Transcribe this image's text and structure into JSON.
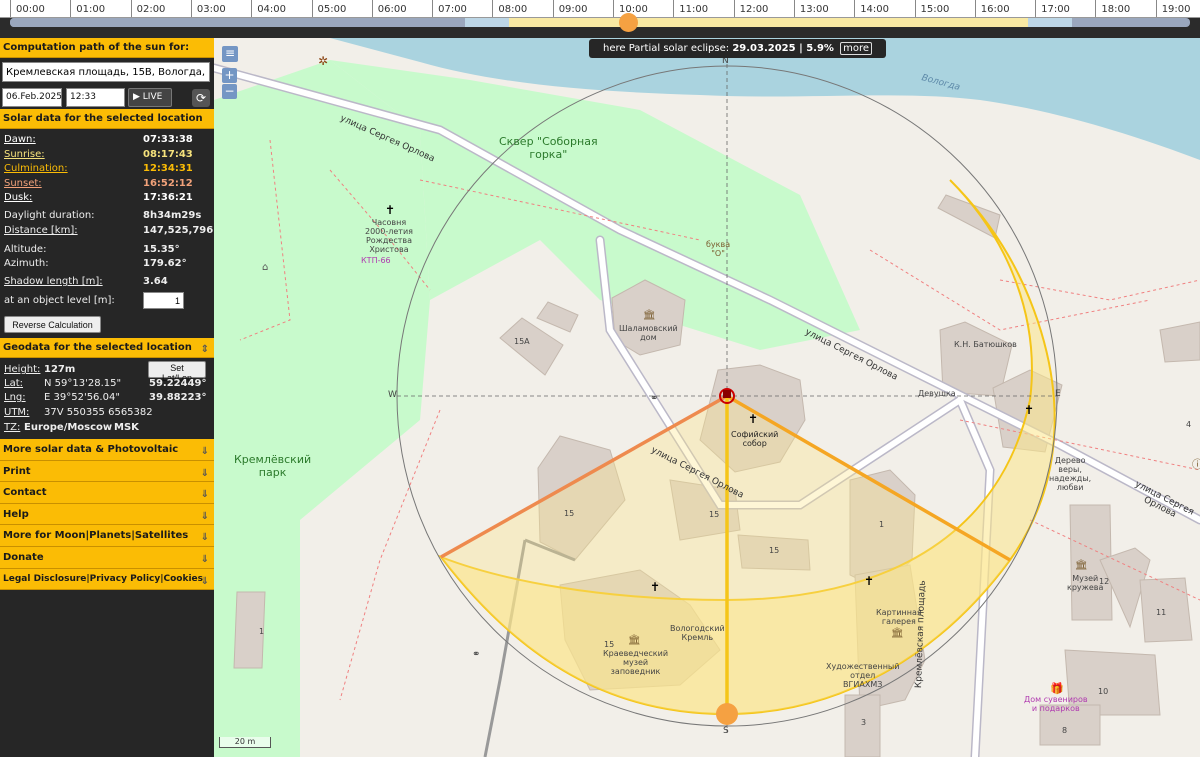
{
  "timeline": {
    "hours": [
      "00:00",
      "01:00",
      "02:00",
      "03:00",
      "04:00",
      "05:00",
      "06:00",
      "07:00",
      "08:00",
      "09:00",
      "10:00",
      "11:00",
      "12:00",
      "13:00",
      "14:00",
      "15:00",
      "16:00",
      "17:00",
      "18:00",
      "19:00"
    ],
    "current_time_fraction": 0.524
  },
  "sidebar": {
    "path_title": "Computation path of the sun for:",
    "address": "Кремлевская площадь, 15B, Вологда, Во...",
    "date": "06.Feb.2025",
    "time": "12:33 UTC+3",
    "live_label": "LIVE",
    "solar_title": "Solar data for the selected location",
    "solar_rows": [
      {
        "label": "Dawn:",
        "value": "07:33:38",
        "color": "#ffffff"
      },
      {
        "label": "Sunrise:",
        "value": "08:17:43",
        "color": "#f6e27c"
      },
      {
        "label": "Culmination:",
        "value": "12:34:31",
        "color": "#fbbc05"
      },
      {
        "label": "Sunset:",
        "value": "16:52:12",
        "color": "#f2a27a"
      },
      {
        "label": "Dusk:",
        "value": "17:36:21",
        "color": "#ffffff"
      }
    ],
    "daylight_label": "Daylight duration:",
    "daylight_value": "8h34m29s",
    "distance_label": "Distance [km]:",
    "distance_value": "147,525,796",
    "altitude_label": "Altitude:",
    "altitude_value": "15.35°",
    "azimuth_label": "Azimuth:",
    "azimuth_value": "179.62°",
    "shadow_label": "Shadow length [m]:",
    "shadow_value": "3.64",
    "object_label": "at an object level [m]:",
    "object_value": "1",
    "reverse_button": "Reverse Calculation",
    "geo_title": "Geodata for the selected location",
    "height_label": "Height:",
    "height_value": "127m",
    "setlatlon_button": "Set Lat/Lon",
    "lat_label": "Lat:",
    "lat_dms": "N 59°13'28.15\"",
    "lat_dec": "59.22449°",
    "lng_label": "Lng:",
    "lng_dms": "E 39°52'56.04\"",
    "lng_dec": "39.88223°",
    "utm_label": "UTM:",
    "utm_value": "37V 550355 6565382",
    "tz_label": "TZ:",
    "tz_value": "Europe/Moscow",
    "tz_abbr": "MSK",
    "menu": [
      "More solar data & Photovoltaic",
      "Print",
      "Contact",
      "Help",
      "More for Moon|Planets|Satellites",
      "Donate",
      "Legal Disclosure|Privacy Policy|Cookies"
    ]
  },
  "map": {
    "eclipse_text": "here Partial solar eclipse:",
    "eclipse_date": "29.03.2025 | 5.9%",
    "eclipse_more": "more",
    "compass": {
      "n": "N",
      "s": "S",
      "e": "E",
      "w": "W"
    },
    "scale": "20 m",
    "street_labels": [
      "улица Сергея Орлова",
      "улица Сергея Орлова",
      "улица Сергея Орлова",
      "улица Сергея Орлова",
      "Кремлёвская площадь"
    ],
    "labels": {
      "park": "Кремлёвский\nпарк",
      "square": "Сквер \"Соборная\nгорка\"",
      "vologda": "Вологда",
      "chapel": "Часовня\n2000-летия\nРождества\nХристова",
      "ktp": "КТП-66",
      "bukva": "буква\n\"О\"",
      "shalamov": "Шаламовский\nдом",
      "sofia": "Софийский\nсобор",
      "batyushkov": "К.Н. Батюшков",
      "devushka": "Девушка",
      "derevo": "Дерево\nверы,\nнадежды,\nлюбви",
      "kremlin": "Вологодский\nКремль",
      "museum": "Краеведческий\nмузей\nзаповедник",
      "gallery": "Картинная\nгалерея",
      "art": "Художественный\nотдел\nВГИАХМЗ",
      "kruzheva": "Музей\nкружева",
      "souvenirs": "Дом сувениров\nи подарков",
      "n15a": "15А",
      "n15": "15",
      "n15b": "15",
      "n15c": "15",
      "n15d": "15",
      "n1": "1",
      "n1b": "1",
      "n12": "12",
      "n11": "11",
      "n10": "10",
      "n8": "8",
      "n3": "3",
      "n4": "4"
    }
  }
}
